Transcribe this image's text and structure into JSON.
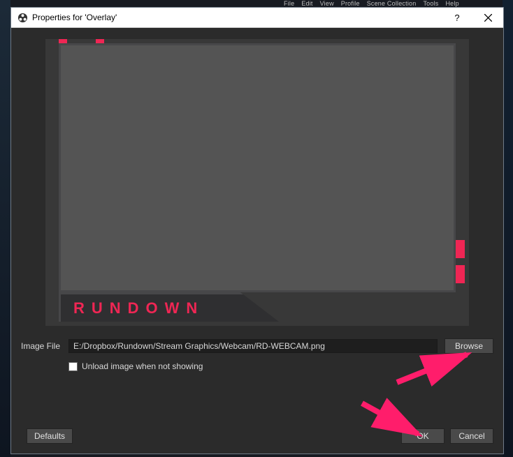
{
  "window": {
    "title": "Properties for 'Overlay'"
  },
  "preview": {
    "brand_text": "RUNDOWN",
    "accent_color": "#ef2654"
  },
  "form": {
    "image_file_label": "Image File",
    "image_file_value": "E:/Dropbox/Rundown/Stream Graphics/Webcam/RD-WEBCAM.png",
    "browse_label": "Browse",
    "unload_label": "Unload image when not showing",
    "unload_checked": false
  },
  "buttons": {
    "defaults": "Defaults",
    "ok": "OK",
    "cancel": "Cancel"
  },
  "bg_menu": [
    "File",
    "Edit",
    "View",
    "Profile",
    "Scene Collection",
    "Tools",
    "Help"
  ]
}
